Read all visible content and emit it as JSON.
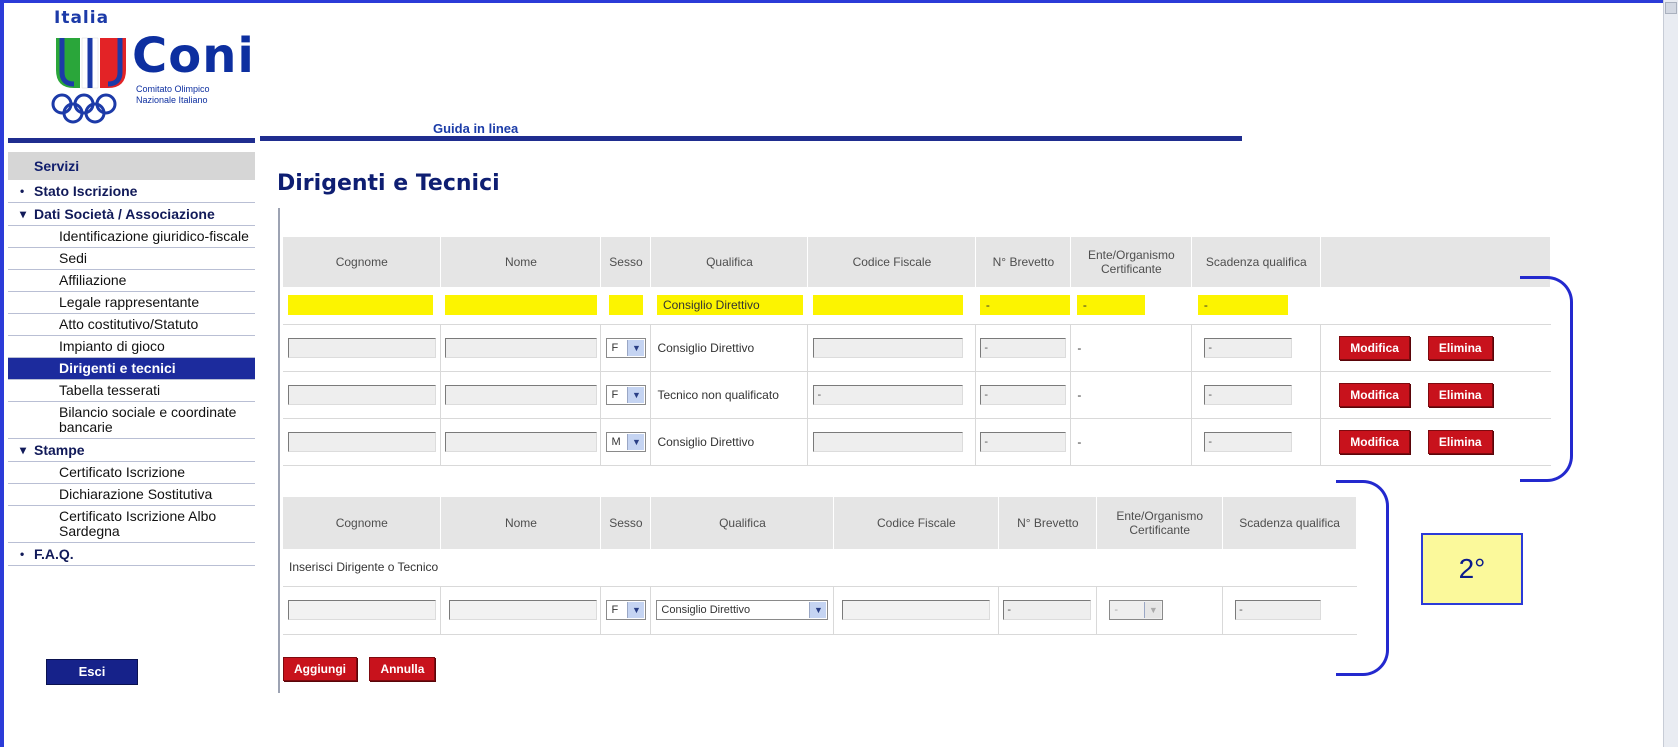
{
  "logo": {
    "top_text": "Italia",
    "name": "Coni",
    "subtitle_line1": "Comitato Olimpico",
    "subtitle_line2": "Nazionale Italiano"
  },
  "header": {
    "guida_label": "Guida in linea"
  },
  "sidebar": {
    "head": "Servizi",
    "stato": "Stato Iscrizione",
    "dati": "Dati Società / Associazione",
    "dati_items": [
      "Identificazione giuridico-fiscale",
      "Sedi",
      "Affiliazione",
      "Legale rappresentante",
      "Atto costitutivo/Statuto",
      "Impianto di gioco",
      "Dirigenti e tecnici",
      "Tabella tesserati",
      "Bilancio sociale e coordinate bancarie"
    ],
    "stampe": "Stampe",
    "stampe_items": [
      "Certificato Iscrizione",
      "Dichiarazione Sostitutiva",
      "Certificato Iscrizione Albo Sardegna"
    ],
    "faq": "F.A.Q.",
    "esci": "Esci"
  },
  "main": {
    "title": "Dirigenti e Tecnici",
    "columns": [
      "Cognome",
      "Nome",
      "Sesso",
      "Qualifica",
      "Codice Fiscale",
      "N° Brevetto",
      "Ente/Organismo Certificante",
      "Scadenza qualifica"
    ],
    "existing_rows": [
      {
        "sesso": "F",
        "qualifica": "Consiglio Direttivo",
        "brevetto": "-",
        "ente": "-",
        "scadenza": "-"
      },
      {
        "sesso": "F",
        "qualifica": "Tecnico non qualificato",
        "codice": "-",
        "brevetto": "-",
        "ente": "-",
        "scadenza": "-"
      },
      {
        "sesso": "M",
        "qualifica": "Consiglio Direttivo",
        "brevetto": "-",
        "ente": "-",
        "scadenza": "-"
      }
    ],
    "highlight_row": {
      "qualifica": "Consiglio Direttivo",
      "dash": "-"
    },
    "modifica": "Modifica",
    "elimina": "Elimina",
    "add_label": "Inserisci Dirigente o Tecnico",
    "new_row": {
      "sesso": "F",
      "qualifica": "Consiglio Direttivo",
      "brevetto": "-",
      "ente": "-",
      "scadenza": "-"
    },
    "aggiungi": "Aggiungi",
    "annulla": "Annulla"
  },
  "callout": {
    "label": "2°"
  },
  "colors": {
    "brand_blue": "#1c2b9d",
    "highlight_yellow": "#fcf400",
    "action_red": "#c8121c",
    "annotation_blue": "#2329ce"
  }
}
